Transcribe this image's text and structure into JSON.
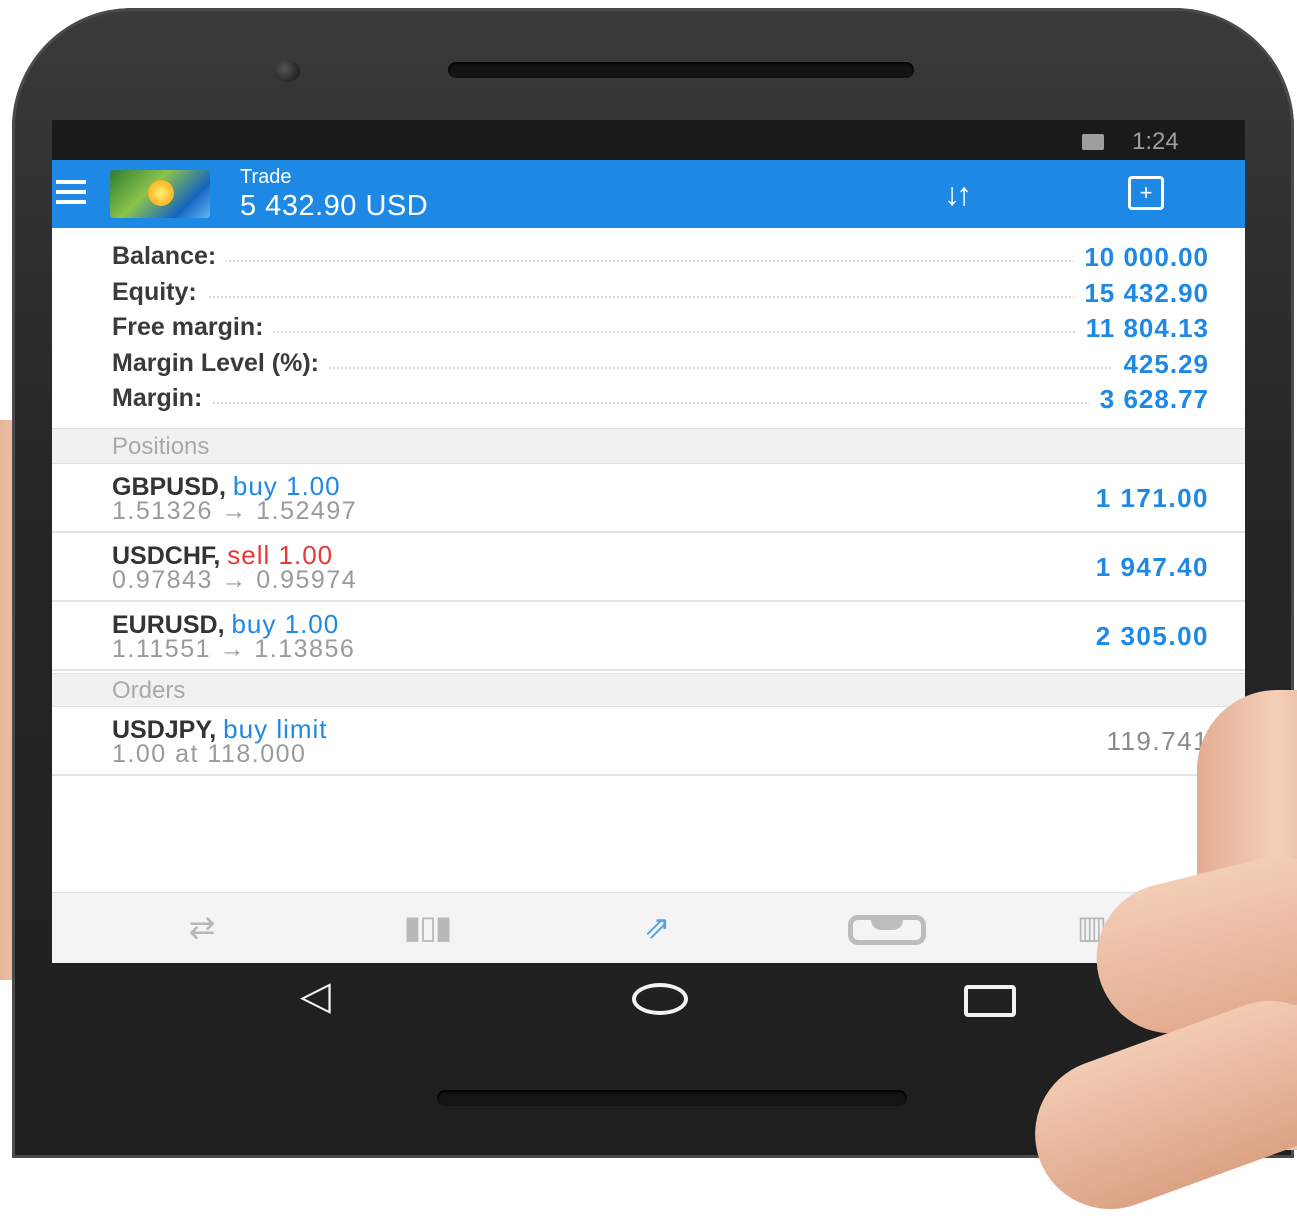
{
  "status_bar": {
    "time": "1:24"
  },
  "app_bar": {
    "title": "Trade",
    "subtitle": "5 432.90 USD",
    "sort_icon": "sort-icon",
    "new_order_icon": "new-order-icon"
  },
  "summary": [
    {
      "label": "Balance:",
      "value": "10 000.00"
    },
    {
      "label": "Equity:",
      "value": "15 432.90"
    },
    {
      "label": "Free margin:",
      "value": "11 804.13"
    },
    {
      "label": "Margin Level (%):",
      "value": "425.29"
    },
    {
      "label": "Margin:",
      "value": "3 628.77"
    }
  ],
  "positions": {
    "header": "Positions",
    "items": [
      {
        "symbol": "GBPUSD,",
        "action": "buy 1.00",
        "prices": "1.51326 → 1.52497",
        "profit": "1 171.00"
      },
      {
        "symbol": "USDCHF,",
        "action": "sell 1.00",
        "prices": "0.97843 → 0.95974",
        "profit": "1 947.40"
      },
      {
        "symbol": "EURUSD,",
        "action": "buy 1.00",
        "prices": "1.11551 → 1.13856",
        "profit": "2 305.00"
      }
    ]
  },
  "orders": {
    "header": "Orders",
    "items": [
      {
        "symbol": "USDJPY,",
        "action": "buy limit",
        "details": "1.00 at 118.000",
        "price": "119.741"
      }
    ]
  },
  "bottom_nav": [
    "quotes-icon",
    "charts-icon",
    "trade-icon",
    "history-icon",
    "news-icon"
  ],
  "colors": {
    "accent": "#1e88e5",
    "sell": "#e53935",
    "status_bar": "#1a1a1a"
  }
}
